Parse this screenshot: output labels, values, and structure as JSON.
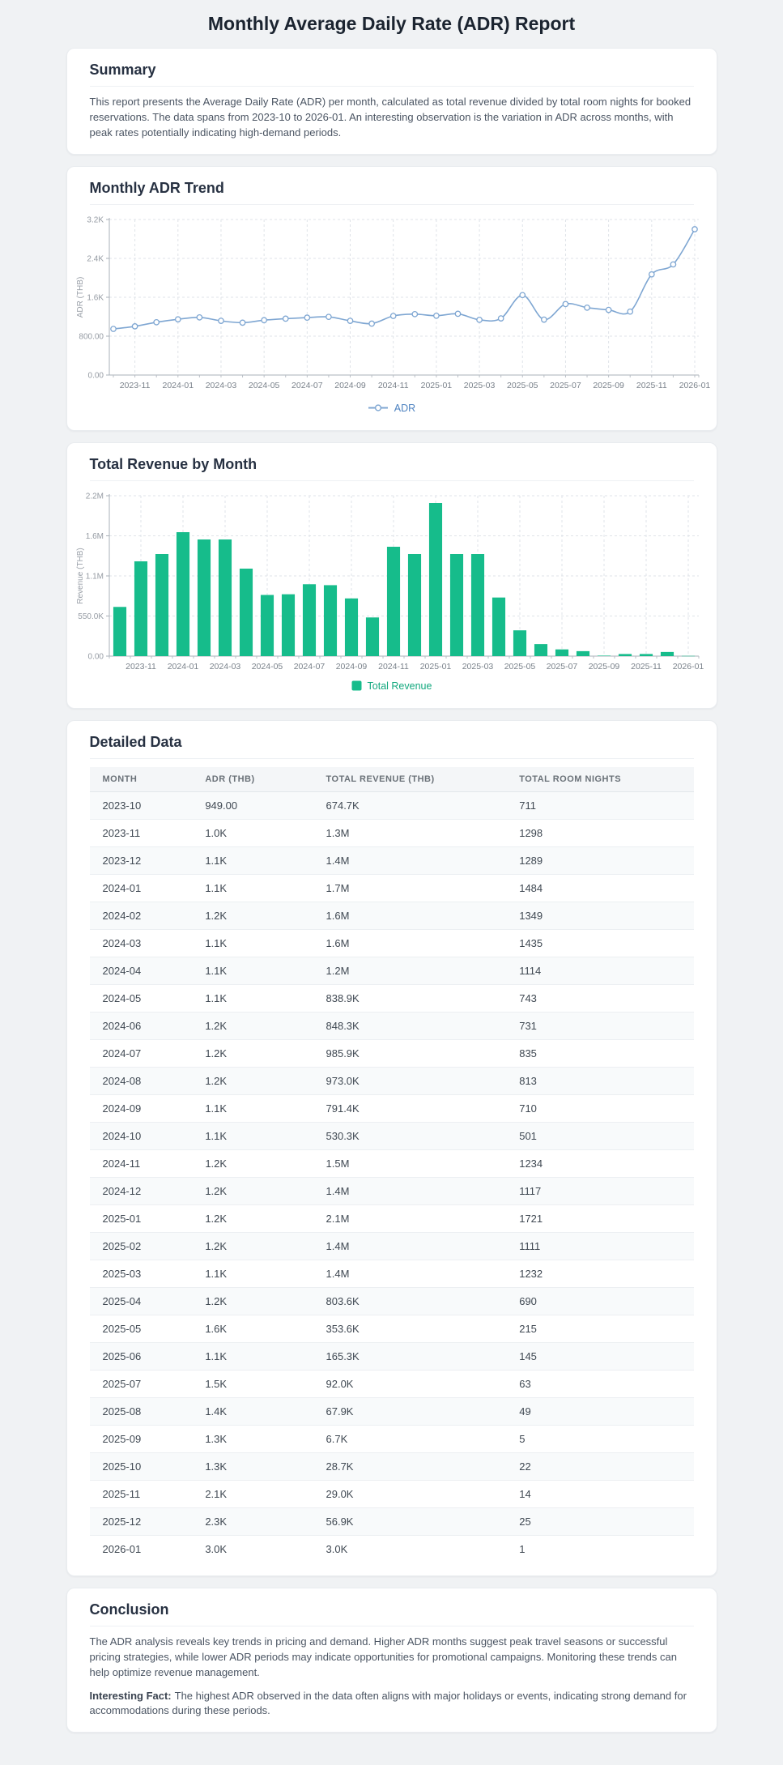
{
  "page_title": "Monthly Average Daily Rate (ADR) Report",
  "summary": {
    "heading": "Summary",
    "body": "This report presents the Average Daily Rate (ADR) per month, calculated as total revenue divided by total room nights for booked reservations. The data spans from 2023-10 to 2026-01. An interesting observation is the variation in ADR across months, with peak rates potentially indicating high-demand periods."
  },
  "chart_data": [
    {
      "type": "line",
      "title": "Monthly ADR Trend",
      "ylabel": "ADR (THB)",
      "legend": "ADR",
      "color": "#7ea6d2",
      "legend_text_color": "#4d82c0",
      "y_max": 3200,
      "y_tick_labels": [
        "0.00",
        "800.00",
        "1.6K",
        "2.4K",
        "3.2K"
      ],
      "categories": [
        "2023-10",
        "2023-11",
        "2023-12",
        "2024-01",
        "2024-02",
        "2024-03",
        "2024-04",
        "2024-05",
        "2024-06",
        "2024-07",
        "2024-08",
        "2024-09",
        "2024-10",
        "2024-11",
        "2024-12",
        "2025-01",
        "2025-02",
        "2025-03",
        "2025-04",
        "2025-05",
        "2025-06",
        "2025-07",
        "2025-08",
        "2025-09",
        "2025-10",
        "2025-11",
        "2025-12",
        "2026-01"
      ],
      "values": [
        949,
        1002,
        1086,
        1146,
        1186,
        1115,
        1077,
        1129,
        1160,
        1181,
        1197,
        1115,
        1058,
        1216,
        1253,
        1220,
        1260,
        1136,
        1165,
        1645,
        1140,
        1460,
        1386,
        1340,
        1305,
        2071,
        2276,
        3000
      ],
      "x_ticks": [
        {
          "i": 1,
          "label": "2023-11"
        },
        {
          "i": 3,
          "label": "2024-01"
        },
        {
          "i": 5,
          "label": "2024-03"
        },
        {
          "i": 7,
          "label": "2024-05"
        },
        {
          "i": 9,
          "label": "2024-07"
        },
        {
          "i": 11,
          "label": "2024-09"
        },
        {
          "i": 13,
          "label": "2024-11"
        },
        {
          "i": 15,
          "label": "2025-01"
        },
        {
          "i": 17,
          "label": "2025-03"
        },
        {
          "i": 19,
          "label": "2025-05"
        },
        {
          "i": 21,
          "label": "2025-07"
        },
        {
          "i": 23,
          "label": "2025-09"
        },
        {
          "i": 25,
          "label": "2025-11"
        },
        {
          "i": 27,
          "label": "2026-01"
        }
      ]
    },
    {
      "type": "bar",
      "title": "Total Revenue by Month",
      "ylabel": "Revenue (THB)",
      "legend": "Total Revenue",
      "color": "#16bc8b",
      "legend_text_color": "#13a87e",
      "y_max": 2200000,
      "y_tick_labels": [
        "0.00",
        "550.0K",
        "1.1M",
        "1.6M",
        "2.2M"
      ],
      "categories": [
        "2023-10",
        "2023-11",
        "2023-12",
        "2024-01",
        "2024-02",
        "2024-03",
        "2024-04",
        "2024-05",
        "2024-06",
        "2024-07",
        "2024-08",
        "2024-09",
        "2024-10",
        "2024-11",
        "2024-12",
        "2025-01",
        "2025-02",
        "2025-03",
        "2025-04",
        "2025-05",
        "2025-06",
        "2025-07",
        "2025-08",
        "2025-09",
        "2025-10",
        "2025-11",
        "2025-12",
        "2026-01"
      ],
      "values": [
        674700,
        1300000,
        1400000,
        1700000,
        1600000,
        1600000,
        1200000,
        838900,
        848300,
        985900,
        973000,
        791400,
        530300,
        1500000,
        1400000,
        2100000,
        1400000,
        1400000,
        803600,
        353600,
        165300,
        92000,
        67900,
        6700,
        28700,
        29000,
        56900,
        3000
      ],
      "x_ticks": [
        {
          "i": 1,
          "label": "2023-11"
        },
        {
          "i": 3,
          "label": "2024-01"
        },
        {
          "i": 5,
          "label": "2024-03"
        },
        {
          "i": 7,
          "label": "2024-05"
        },
        {
          "i": 9,
          "label": "2024-07"
        },
        {
          "i": 11,
          "label": "2024-09"
        },
        {
          "i": 13,
          "label": "2024-11"
        },
        {
          "i": 15,
          "label": "2025-01"
        },
        {
          "i": 17,
          "label": "2025-03"
        },
        {
          "i": 19,
          "label": "2025-05"
        },
        {
          "i": 21,
          "label": "2025-07"
        },
        {
          "i": 23,
          "label": "2025-09"
        },
        {
          "i": 25,
          "label": "2025-11"
        },
        {
          "i": 27,
          "label": "2026-01"
        }
      ]
    }
  ],
  "table": {
    "heading": "Detailed Data",
    "columns": [
      "MONTH",
      "ADR (THB)",
      "TOTAL REVENUE (THB)",
      "TOTAL ROOM NIGHTS"
    ],
    "rows": [
      [
        "2023-10",
        "949.00",
        "674.7K",
        "711"
      ],
      [
        "2023-11",
        "1.0K",
        "1.3M",
        "1298"
      ],
      [
        "2023-12",
        "1.1K",
        "1.4M",
        "1289"
      ],
      [
        "2024-01",
        "1.1K",
        "1.7M",
        "1484"
      ],
      [
        "2024-02",
        "1.2K",
        "1.6M",
        "1349"
      ],
      [
        "2024-03",
        "1.1K",
        "1.6M",
        "1435"
      ],
      [
        "2024-04",
        "1.1K",
        "1.2M",
        "1114"
      ],
      [
        "2024-05",
        "1.1K",
        "838.9K",
        "743"
      ],
      [
        "2024-06",
        "1.2K",
        "848.3K",
        "731"
      ],
      [
        "2024-07",
        "1.2K",
        "985.9K",
        "835"
      ],
      [
        "2024-08",
        "1.2K",
        "973.0K",
        "813"
      ],
      [
        "2024-09",
        "1.1K",
        "791.4K",
        "710"
      ],
      [
        "2024-10",
        "1.1K",
        "530.3K",
        "501"
      ],
      [
        "2024-11",
        "1.2K",
        "1.5M",
        "1234"
      ],
      [
        "2024-12",
        "1.2K",
        "1.4M",
        "1117"
      ],
      [
        "2025-01",
        "1.2K",
        "2.1M",
        "1721"
      ],
      [
        "2025-02",
        "1.2K",
        "1.4M",
        "1111"
      ],
      [
        "2025-03",
        "1.1K",
        "1.4M",
        "1232"
      ],
      [
        "2025-04",
        "1.2K",
        "803.6K",
        "690"
      ],
      [
        "2025-05",
        "1.6K",
        "353.6K",
        "215"
      ],
      [
        "2025-06",
        "1.1K",
        "165.3K",
        "145"
      ],
      [
        "2025-07",
        "1.5K",
        "92.0K",
        "63"
      ],
      [
        "2025-08",
        "1.4K",
        "67.9K",
        "49"
      ],
      [
        "2025-09",
        "1.3K",
        "6.7K",
        "5"
      ],
      [
        "2025-10",
        "1.3K",
        "28.7K",
        "22"
      ],
      [
        "2025-11",
        "2.1K",
        "29.0K",
        "14"
      ],
      [
        "2025-12",
        "2.3K",
        "56.9K",
        "25"
      ],
      [
        "2026-01",
        "3.0K",
        "3.0K",
        "1"
      ]
    ]
  },
  "conclusion": {
    "heading": "Conclusion",
    "body": "The ADR analysis reveals key trends in pricing and demand. Higher ADR months suggest peak travel seasons or successful pricing strategies, while lower ADR periods may indicate opportunities for promotional campaigns. Monitoring these trends can help optimize revenue management.",
    "fact_label": "Interesting Fact:",
    "fact_body": "The highest ADR observed in the data often aligns with major holidays or events, indicating strong demand for accommodations during these periods."
  }
}
